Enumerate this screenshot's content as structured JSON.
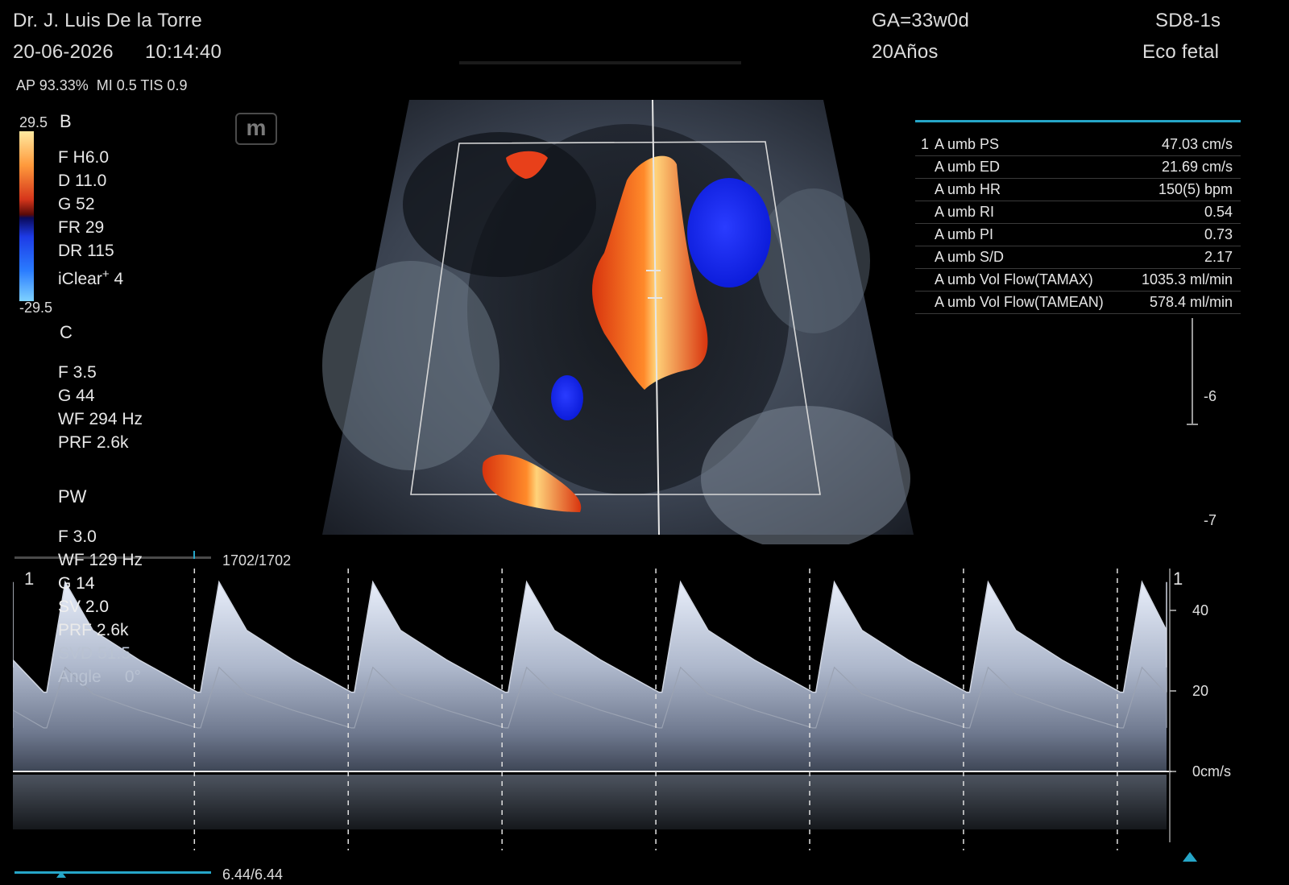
{
  "header": {
    "doctor": "Dr. J. Luis De la Torre",
    "date": "20-06-2026",
    "time": "10:14:40",
    "ga": "GA=33w0d",
    "age": "20Años",
    "probe": "SD8-1s",
    "preset": "Eco fetal",
    "acoustic": "AP 93.33%  MI 0.5 TIS 0.9"
  },
  "colorbar": {
    "max": "29.5",
    "min": "-29.5",
    "colors": [
      "#ffe9a0",
      "#d6361b",
      "#1d3be6",
      "#7fd2ff"
    ]
  },
  "b_mode": {
    "title": "B",
    "params": [
      "F H6.0",
      "D 11.0",
      "G 52",
      "FR 29",
      "DR 115"
    ],
    "iclear_label": "iClear",
    "iclear_sup": "+",
    "iclear_value": "4"
  },
  "c_mode": {
    "title": "C",
    "params": [
      "F 3.5",
      "G 44",
      "WF 294 Hz",
      "PRF 2.6k"
    ]
  },
  "pw_mode": {
    "title": "PW",
    "params": [
      "F 3.0",
      "WF 129 Hz",
      "G 14",
      "SV 2.0",
      "PRF 2.6k",
      "SVD 51.5",
      "Angle     0°"
    ]
  },
  "logo": {
    "icon": "m-logo-icon",
    "letter": "m"
  },
  "frame_counter": "1702/1702",
  "time_counter": "6.44/6.44",
  "measurements": [
    {
      "index": "1",
      "label": "A umb PS",
      "value": "47.03 cm/s"
    },
    {
      "index": "",
      "label": "A umb ED",
      "value": "21.69 cm/s"
    },
    {
      "index": "",
      "label": "A umb HR",
      "value": "150(5) bpm"
    },
    {
      "index": "",
      "label": "A umb RI",
      "value": "0.54"
    },
    {
      "index": "",
      "label": "A umb PI",
      "value": "0.73"
    },
    {
      "index": "",
      "label": "A umb S/D",
      "value": "2.17"
    },
    {
      "index": "",
      "label": "A umb Vol Flow(TAMAX)",
      "value": "1035.3 ml/min"
    },
    {
      "index": "",
      "label": "A umb Vol Flow(TAMEAN)",
      "value": "578.4 ml/min"
    }
  ],
  "depth_scale": {
    "labels": [
      "-6",
      "-7"
    ]
  },
  "spectrum": {
    "cursor_marker_left": "1",
    "cursor_marker_right": "1",
    "velocity_labels": [
      "40",
      "20",
      "0cm/s"
    ],
    "velocity_values": [
      40,
      20,
      0
    ],
    "peak_velocity": 47.03,
    "end_diastolic_velocity": 21.69,
    "cycles": 8
  }
}
